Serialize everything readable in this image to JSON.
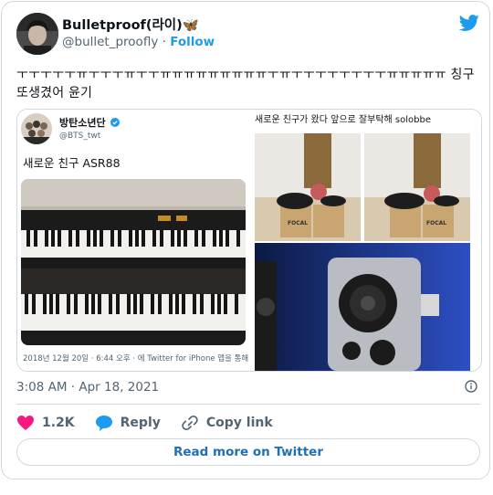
{
  "author": {
    "name": "Bulletproof(라이)🦋",
    "handle": "@bullet_proofly",
    "separator": "·",
    "follow_label": "Follow"
  },
  "tweet": {
    "text": "ㅜㅜㅜㅜㅜㅠㅜㅜㅜㅠㅜㅜㅠㅠㅠㅠㅠㅠㅠㅠㅠㅜㅠㅜㅜㅜㅜㅜㅜㅜㅜㅠㅠㅠㅠㅠ 칭구 또생겼어 윤기"
  },
  "quoted_left": {
    "account_name": "방탄소년단",
    "account_handle": "@BTS_twt",
    "caption": "새로운 친구 ASR88",
    "footer": "2018년 12월 20일 · 6:44 오후 · 에 Twitter for iPhone 앱을 통해"
  },
  "quoted_right": {
    "caption": "새로운 친구가 왔다 앞으로 잘부탁해 solobbe",
    "speaker_brand": "FOCAL"
  },
  "meta": {
    "timestamp": "3:08 AM · Apr 18, 2021"
  },
  "actions": {
    "likes": "1.2K",
    "reply_label": "Reply",
    "copy_link_label": "Copy link"
  },
  "read_more_label": "Read more on Twitter",
  "colors": {
    "brand_blue": "#1d9bf0",
    "like_pink": "#f91880",
    "muted_text": "#536471",
    "border": "#cfd9de"
  },
  "icons": [
    "twitter-bird-icon",
    "verified-badge-icon",
    "info-icon",
    "heart-icon",
    "reply-bubble-icon",
    "link-icon"
  ]
}
